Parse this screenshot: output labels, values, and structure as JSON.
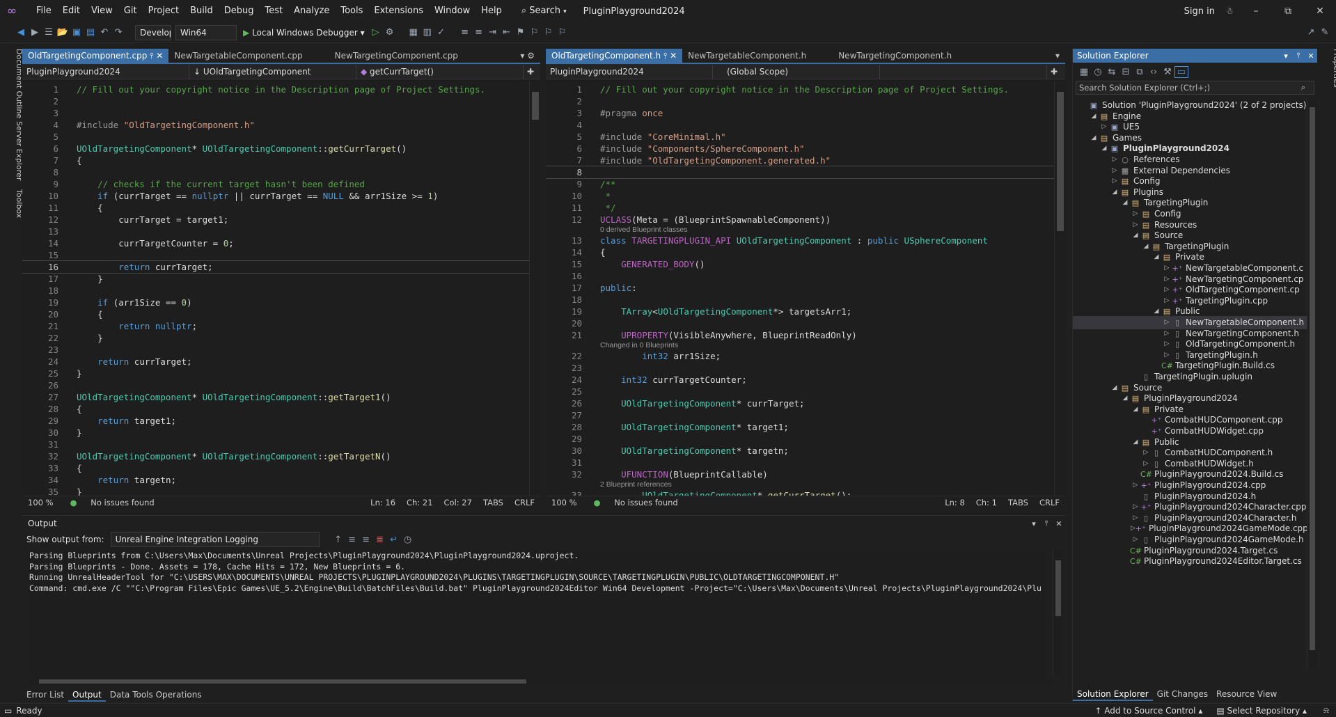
{
  "titlebar": {
    "menus": [
      "File",
      "Edit",
      "View",
      "Git",
      "Project",
      "Build",
      "Debug",
      "Test",
      "Analyze",
      "Tools",
      "Extensions",
      "Window",
      "Help"
    ],
    "search": "Search",
    "solution_name": "PluginPlayground2024",
    "sign_in": "Sign in"
  },
  "toolbar": {
    "configuration": "Developi",
    "platform": "Win64",
    "debugger": "Local Windows Debugger"
  },
  "left_sidebar": [
    "Document Outline",
    "Server Explorer",
    "Toolbox"
  ],
  "right_sidebar": "Properties",
  "left_editor": {
    "tabs": [
      "OldTargetingComponent.cpp",
      "NewTargetableComponent.cpp",
      "NewTargetingComponent.cpp"
    ],
    "nav": [
      "PluginPlayground2024",
      "UOldTargetingComponent",
      "getCurrTarget()"
    ],
    "lines": [
      [
        "1",
        "// Fill out your copyright notice in the Description page of Project Settings."
      ],
      [
        "2",
        ""
      ],
      [
        "3",
        ""
      ],
      [
        "4",
        "#include \"OldTargetingComponent.h\""
      ],
      [
        "5",
        ""
      ],
      [
        "6",
        "UOldTargetingComponent* UOldTargetingComponent::getCurrTarget()"
      ],
      [
        "7",
        "{"
      ],
      [
        "8",
        ""
      ],
      [
        "9",
        "    // checks if the current target hasn't been defined"
      ],
      [
        "10",
        "    if (currTarget == nullptr || currTarget == NULL && arr1Size >= 1)"
      ],
      [
        "11",
        "    {"
      ],
      [
        "12",
        "        currTarget = target1;"
      ],
      [
        "13",
        ""
      ],
      [
        "14",
        "        currTargetCounter = 0;"
      ],
      [
        "15",
        ""
      ],
      [
        "16",
        "        return currTarget;"
      ],
      [
        "17",
        "    }"
      ],
      [
        "18",
        ""
      ],
      [
        "19",
        "    if (arr1Size == 0)"
      ],
      [
        "20",
        "    {"
      ],
      [
        "21",
        "        return nullptr;"
      ],
      [
        "22",
        "    }"
      ],
      [
        "23",
        ""
      ],
      [
        "24",
        "    return currTarget;"
      ],
      [
        "25",
        "}"
      ],
      [
        "26",
        ""
      ],
      [
        "27",
        "UOldTargetingComponent* UOldTargetingComponent::getTarget1()"
      ],
      [
        "28",
        "{"
      ],
      [
        "29",
        "    return target1;"
      ],
      [
        "30",
        "}"
      ],
      [
        "31",
        ""
      ],
      [
        "32",
        "UOldTargetingComponent* UOldTargetingComponent::getTargetN()"
      ],
      [
        "33",
        "{"
      ],
      [
        "34",
        "    return targetn;"
      ],
      [
        "35",
        "}"
      ]
    ],
    "status": {
      "zoom": "100 %",
      "issues": "No issues found",
      "ln": "Ln: 16",
      "ch": "Ch: 21",
      "col": "Col: 27",
      "tabs": "TABS",
      "eol": "CRLF"
    }
  },
  "right_editor": {
    "tabs": [
      "OldTargetingComponent.h",
      "NewTargetableComponent.h",
      "NewTargetingComponent.h"
    ],
    "nav": [
      "PluginPlayground2024",
      "(Global Scope)"
    ],
    "lines": [
      [
        "1",
        "// Fill out your copyright notice in the Description page of Project Settings."
      ],
      [
        "2",
        ""
      ],
      [
        "3",
        "#pragma once"
      ],
      [
        "4",
        ""
      ],
      [
        "5",
        "#include \"CoreMinimal.h\""
      ],
      [
        "6",
        "#include \"Components/SphereComponent.h\""
      ],
      [
        "7",
        "#include \"OldTargetingComponent.generated.h\""
      ],
      [
        "8",
        ""
      ],
      [
        "9",
        "/**"
      ],
      [
        "10",
        " *"
      ],
      [
        "11",
        " */"
      ],
      [
        "12",
        "UCLASS(Meta = (BlueprintSpawnableComponent))"
      ],
      [
        "13",
        "class TARGETINGPLUGIN_API UOldTargetingComponent : public USphereComponent"
      ],
      [
        "14",
        "{"
      ],
      [
        "15",
        "    GENERATED_BODY()"
      ],
      [
        "16",
        ""
      ],
      [
        "17",
        "public:"
      ],
      [
        "18",
        ""
      ],
      [
        "19",
        "    TArray<UOldTargetingComponent*> targetsArr1;"
      ],
      [
        "20",
        ""
      ],
      [
        "21",
        "    UPROPERTY(VisibleAnywhere, BlueprintReadOnly)"
      ],
      [
        "22",
        "        int32 arr1Size;"
      ],
      [
        "23",
        ""
      ],
      [
        "24",
        "    int32 currTargetCounter;"
      ],
      [
        "25",
        ""
      ],
      [
        "26",
        "    UOldTargetingComponent* currTarget;"
      ],
      [
        "27",
        ""
      ],
      [
        "28",
        "    UOldTargetingComponent* target1;"
      ],
      [
        "29",
        ""
      ],
      [
        "30",
        "    UOldTargetingComponent* targetn;"
      ],
      [
        "31",
        ""
      ],
      [
        "32",
        "    UFUNCTION(BlueprintCallable)"
      ],
      [
        "33",
        "        UOldTargetingComponent* getCurrTarget();"
      ]
    ],
    "hints": [
      "0 derived Blueprint classes",
      "Changed in 0 Blueprints",
      "2 Blueprint references"
    ],
    "status": {
      "zoom": "100 %",
      "issues": "No issues found",
      "ln": "Ln: 8",
      "ch": "Ch: 1",
      "tabs": "TABS",
      "eol": "CRLF"
    }
  },
  "output": {
    "title": "Output",
    "show_from_label": "Show output from:",
    "source": "Unreal Engine Integration Logging",
    "lines": [
      "Parsing Blueprints from C:\\Users\\Max\\Documents\\Unreal Projects\\PluginPlayground2024\\PluginPlayground2024.uproject.",
      "Parsing Blueprints - Done. Assets = 178, Cache Hits = 172, New Blueprints = 6.",
      "Running UnrealHeaderTool for \"C:\\USERS\\MAX\\DOCUMENTS\\UNREAL PROJECTS\\PLUGINPLAYGROUND2024\\PLUGINS\\TARGETINGPLUGIN\\SOURCE\\TARGETINGPLUGIN\\PUBLIC\\OLDTARGETINGCOMPONENT.H\"",
      "Command: cmd.exe /C \"\"C:\\Program Files\\Epic Games\\UE_5.2\\Engine\\Build\\BatchFiles\\Build.bat\" PluginPlayground2024Editor Win64 Development -Project=\"C:\\Users\\Max\\Documents\\Unreal Projects\\PluginPlayground2024\\Plu"
    ],
    "tabs": [
      "Error List",
      "Output",
      "Data Tools Operations"
    ]
  },
  "solution_explorer": {
    "title": "Solution Explorer",
    "search_placeholder": "Search Solution Explorer (Ctrl+;)",
    "items": [
      {
        "label": "Solution 'PluginPlayground2024' (2 of 2 projects)",
        "depth": 0,
        "arrow": "",
        "icon": "sln"
      },
      {
        "label": "Engine",
        "depth": 1,
        "arrow": "open",
        "icon": "folder"
      },
      {
        "label": "UE5",
        "depth": 2,
        "arrow": "closed",
        "icon": "proj"
      },
      {
        "label": "Games",
        "depth": 1,
        "arrow": "open",
        "icon": "folder"
      },
      {
        "label": "PluginPlayground2024",
        "depth": 2,
        "arrow": "open",
        "icon": "proj",
        "bold": true
      },
      {
        "label": "References",
        "depth": 3,
        "arrow": "closed",
        "icon": "ref"
      },
      {
        "label": "External Dependencies",
        "depth": 3,
        "arrow": "closed",
        "icon": "ext"
      },
      {
        "label": "Config",
        "depth": 3,
        "arrow": "closed",
        "icon": "folder"
      },
      {
        "label": "Plugins",
        "depth": 3,
        "arrow": "open",
        "icon": "folder"
      },
      {
        "label": "TargetingPlugin",
        "depth": 4,
        "arrow": "open",
        "icon": "folder"
      },
      {
        "label": "Config",
        "depth": 5,
        "arrow": "closed",
        "icon": "folder"
      },
      {
        "label": "Resources",
        "depth": 5,
        "arrow": "closed",
        "icon": "folder"
      },
      {
        "label": "Source",
        "depth": 5,
        "arrow": "open",
        "icon": "folder"
      },
      {
        "label": "TargetingPlugin",
        "depth": 6,
        "arrow": "open",
        "icon": "folder"
      },
      {
        "label": "Private",
        "depth": 7,
        "arrow": "open",
        "icon": "folder"
      },
      {
        "label": "NewTargetableComponent.c",
        "depth": 8,
        "arrow": "closed",
        "icon": "cpp"
      },
      {
        "label": "NewTargetingComponent.cp",
        "depth": 8,
        "arrow": "closed",
        "icon": "cpp"
      },
      {
        "label": "OldTargetingComponent.cp",
        "depth": 8,
        "arrow": "closed",
        "icon": "cpp"
      },
      {
        "label": "TargetingPlugin.cpp",
        "depth": 8,
        "arrow": "closed",
        "icon": "cpp"
      },
      {
        "label": "Public",
        "depth": 7,
        "arrow": "open",
        "icon": "folder"
      },
      {
        "label": "NewTargetableComponent.h",
        "depth": 8,
        "arrow": "closed",
        "icon": "h",
        "selected": true
      },
      {
        "label": "NewTargetingComponent.h",
        "depth": 8,
        "arrow": "closed",
        "icon": "h"
      },
      {
        "label": "OldTargetingComponent.h",
        "depth": 8,
        "arrow": "closed",
        "icon": "h"
      },
      {
        "label": "TargetingPlugin.h",
        "depth": 8,
        "arrow": "closed",
        "icon": "h"
      },
      {
        "label": "TargetingPlugin.Build.cs",
        "depth": 7,
        "arrow": "",
        "icon": "cs"
      },
      {
        "label": "TargetingPlugin.uplugin",
        "depth": 5,
        "arrow": "",
        "icon": "file"
      },
      {
        "label": "Source",
        "depth": 3,
        "arrow": "open",
        "icon": "folder"
      },
      {
        "label": "PluginPlayground2024",
        "depth": 4,
        "arrow": "open",
        "icon": "folder"
      },
      {
        "label": "Private",
        "depth": 5,
        "arrow": "open",
        "icon": "folder"
      },
      {
        "label": "CombatHUDComponent.cpp",
        "depth": 6,
        "arrow": "",
        "icon": "cpp"
      },
      {
        "label": "CombatHUDWidget.cpp",
        "depth": 6,
        "arrow": "",
        "icon": "cpp"
      },
      {
        "label": "Public",
        "depth": 5,
        "arrow": "open",
        "icon": "folder"
      },
      {
        "label": "CombatHUDComponent.h",
        "depth": 6,
        "arrow": "closed",
        "icon": "h"
      },
      {
        "label": "CombatHUDWidget.h",
        "depth": 6,
        "arrow": "closed",
        "icon": "h"
      },
      {
        "label": "PluginPlayground2024.Build.cs",
        "depth": 5,
        "arrow": "",
        "icon": "cs"
      },
      {
        "label": "PluginPlayground2024.cpp",
        "depth": 5,
        "arrow": "closed",
        "icon": "cpp"
      },
      {
        "label": "PluginPlayground2024.h",
        "depth": 5,
        "arrow": "",
        "icon": "h"
      },
      {
        "label": "PluginPlayground2024Character.cpp",
        "depth": 5,
        "arrow": "closed",
        "icon": "cpp"
      },
      {
        "label": "PluginPlayground2024Character.h",
        "depth": 5,
        "arrow": "closed",
        "icon": "h"
      },
      {
        "label": "PluginPlayground2024GameMode.cpp",
        "depth": 5,
        "arrow": "closed",
        "icon": "cpp"
      },
      {
        "label": "PluginPlayground2024GameMode.h",
        "depth": 5,
        "arrow": "closed",
        "icon": "h"
      },
      {
        "label": "PluginPlayground2024.Target.cs",
        "depth": 4,
        "arrow": "",
        "icon": "cs"
      },
      {
        "label": "PluginPlayground2024Editor.Target.cs",
        "depth": 4,
        "arrow": "",
        "icon": "cs"
      }
    ],
    "tabs": [
      "Solution Explorer",
      "Git Changes",
      "Resource View"
    ]
  },
  "statusbar": {
    "ready": "Ready",
    "add_source": "Add to Source Control",
    "select_repo": "Select Repository"
  },
  "colors": {
    "accent": "#3b6ea5",
    "keyword": "#569cd6",
    "type": "#4ec9b0",
    "string": "#d69d85",
    "comment": "#57a64a",
    "function": "#dcdcaa",
    "macro": "#bd63c5",
    "number": "#b5cea8"
  }
}
